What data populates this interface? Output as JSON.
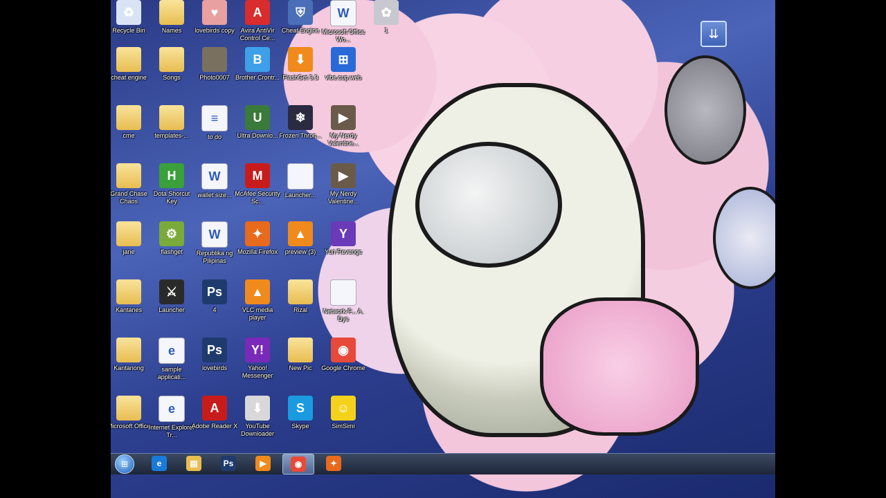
{
  "desktop": {
    "icons": [
      {
        "label": "Recycle Bin",
        "icon": "recycle-bin-icon",
        "color": "#d8e4f4",
        "glyph": "♻"
      },
      {
        "label": "Names",
        "icon": "folder-icon",
        "color": "#e8bd52",
        "glyph": ""
      },
      {
        "label": "lovebirds copy",
        "icon": "image-icon",
        "color": "#e9a0a0",
        "glyph": "♥"
      },
      {
        "label": "Avira AntiVir Control Ce...",
        "icon": "avira-icon",
        "color": "#d92c2c",
        "glyph": "A"
      },
      {
        "label": "Cheat Engine",
        "icon": "shield-icon",
        "color": "#4a6fb8",
        "glyph": "⛨"
      },
      {
        "label": "Microsoft Office Wo...",
        "icon": "word-doc-icon",
        "color": "#f4f6fb",
        "glyph": "W"
      },
      {
        "label": "1",
        "icon": "image-icon",
        "color": "#c8c8d0",
        "glyph": "✿"
      },
      {
        "label": "cheat engine",
        "icon": "folder-icon",
        "color": "#e8bd52",
        "glyph": ""
      },
      {
        "label": "Songs",
        "icon": "folder-icon",
        "color": "#e8bd52",
        "glyph": ""
      },
      {
        "label": "Photo0007",
        "icon": "photo-icon",
        "color": "#7a7060",
        "glyph": ""
      },
      {
        "label": "Brother Crontr...",
        "icon": "brother-icon",
        "color": "#3da0e8",
        "glyph": "B"
      },
      {
        "label": "FlashGet 3.3",
        "icon": "flashget-icon",
        "color": "#f08a1c",
        "glyph": "⬇"
      },
      {
        "label": "vibe.cup.web",
        "icon": "windows-icon",
        "color": "#2a6ad8",
        "glyph": "⊞"
      },
      {
        "label": "cme",
        "icon": "folder-icon",
        "color": "#e8bd52",
        "glyph": ""
      },
      {
        "label": "templates-...",
        "icon": "folder-icon",
        "color": "#e8bd52",
        "glyph": ""
      },
      {
        "label": "to do",
        "icon": "notepad-icon",
        "color": "#f4f6fb",
        "glyph": "≡"
      },
      {
        "label": "Ultra Downlo...",
        "icon": "download-icon",
        "color": "#3a7a3a",
        "glyph": "U"
      },
      {
        "label": "Frozen Thron...",
        "icon": "game-icon",
        "color": "#2a2a40",
        "glyph": "❄"
      },
      {
        "label": "My Nerdy Valentine...",
        "icon": "video-icon",
        "color": "#6a5a4a",
        "glyph": "▶"
      },
      {
        "label": "Grand Chase Chaos",
        "icon": "folder-icon",
        "color": "#e8bd52",
        "glyph": ""
      },
      {
        "label": "Dota Shorcut Key",
        "icon": "hotkey-icon",
        "color": "#3aa03a",
        "glyph": "H"
      },
      {
        "label": "wallet size...",
        "icon": "word-doc-icon",
        "color": "#f4f6fb",
        "glyph": "W"
      },
      {
        "label": "McAfee Security Sc...",
        "icon": "mcafee-icon",
        "color": "#c81c1c",
        "glyph": "M"
      },
      {
        "label": "Launcher...",
        "icon": "file-icon",
        "color": "#f4f6fb",
        "glyph": ""
      },
      {
        "label": "My Nerdy Valentine...",
        "icon": "video-icon",
        "color": "#6a5a4a",
        "glyph": "▶"
      },
      {
        "label": "jane",
        "icon": "folder-icon",
        "color": "#e8bd52",
        "glyph": ""
      },
      {
        "label": "flashget",
        "icon": "installer-icon",
        "color": "#7aaa3a",
        "glyph": "⚙"
      },
      {
        "label": "Republika ng Pilipinas",
        "icon": "word-doc-icon",
        "color": "#f4f6fb",
        "glyph": "W"
      },
      {
        "label": "Mozilla Firefox",
        "icon": "firefox-icon",
        "color": "#e86a1c",
        "glyph": "✦"
      },
      {
        "label": "preview (3)",
        "icon": "vlc-icon",
        "color": "#f08a1c",
        "glyph": "▲"
      },
      {
        "label": "Yuri Revenge",
        "icon": "game-icon",
        "color": "#6a3ab8",
        "glyph": "Y"
      },
      {
        "label": "Kantanes",
        "icon": "folder-icon",
        "color": "#e8bd52",
        "glyph": ""
      },
      {
        "label": "Launcher",
        "icon": "game-icon",
        "color": "#2a2a2a",
        "glyph": "⚔"
      },
      {
        "label": "4",
        "icon": "photoshop-icon",
        "color": "#1f3b6e",
        "glyph": "Ps"
      },
      {
        "label": "VLC media player",
        "icon": "vlc-icon",
        "color": "#f08a1c",
        "glyph": "▲"
      },
      {
        "label": "Rizal",
        "icon": "folder-icon",
        "color": "#e8bd52",
        "glyph": ""
      },
      {
        "label": "Network-F... A. Dye",
        "icon": "pdf-icon",
        "color": "#f4f6fb",
        "glyph": ""
      },
      {
        "label": "Kantanong",
        "icon": "folder-icon",
        "color": "#e8bd52",
        "glyph": ""
      },
      {
        "label": "sample applicati...",
        "icon": "ie-icon",
        "color": "#f4f6fb",
        "glyph": "e"
      },
      {
        "label": "lovebirds",
        "icon": "photoshop-icon",
        "color": "#1f3b6e",
        "glyph": "Ps"
      },
      {
        "label": "Yahoo! Messenger",
        "icon": "yahoo-icon",
        "color": "#7a2ab8",
        "glyph": "Y!"
      },
      {
        "label": "New Pic",
        "icon": "folder-icon",
        "color": "#e8bd52",
        "glyph": ""
      },
      {
        "label": "Google Chrome",
        "icon": "chrome-icon",
        "color": "#e84a3a",
        "glyph": "◉"
      },
      {
        "label": "Microsoft Office",
        "icon": "folder-icon",
        "color": "#e8bd52",
        "glyph": ""
      },
      {
        "label": "Internet Explorer Tr...",
        "icon": "ie-icon",
        "color": "#f4f6fb",
        "glyph": "e"
      },
      {
        "label": "Adobe Reader X",
        "icon": "adobe-reader-icon",
        "color": "#c81c1c",
        "glyph": "A"
      },
      {
        "label": "YouTube Downloader",
        "icon": "youtube-downloader-icon",
        "color": "#d8d8d8",
        "glyph": "⬇"
      },
      {
        "label": "Skype",
        "icon": "skype-icon",
        "color": "#1a9be0",
        "glyph": "S"
      },
      {
        "label": "SimSimi",
        "icon": "simsimi-icon",
        "color": "#f4d21c",
        "glyph": "☺"
      }
    ]
  },
  "taskbar": {
    "items": [
      {
        "name": "internet-explorer",
        "icon": "ie-icon",
        "color": "#1a7ad8",
        "glyph": "e",
        "active": false
      },
      {
        "name": "windows-explorer",
        "icon": "folder-icon",
        "color": "#e8bd52",
        "glyph": "▤",
        "active": false
      },
      {
        "name": "photoshop",
        "icon": "photoshop-icon",
        "color": "#1f3b6e",
        "glyph": "Ps",
        "active": false
      },
      {
        "name": "media-player",
        "icon": "media-player-icon",
        "color": "#f08a1c",
        "glyph": "▶",
        "active": false
      },
      {
        "name": "google-chrome",
        "icon": "chrome-icon",
        "color": "#e84a3a",
        "glyph": "◉",
        "active": true
      },
      {
        "name": "mozilla-firefox",
        "icon": "firefox-icon",
        "color": "#e86a1c",
        "glyph": "✦",
        "active": false
      }
    ]
  },
  "desktop_widget": {
    "icon": "show-desktop-down-icon",
    "glyph": "⇊"
  }
}
